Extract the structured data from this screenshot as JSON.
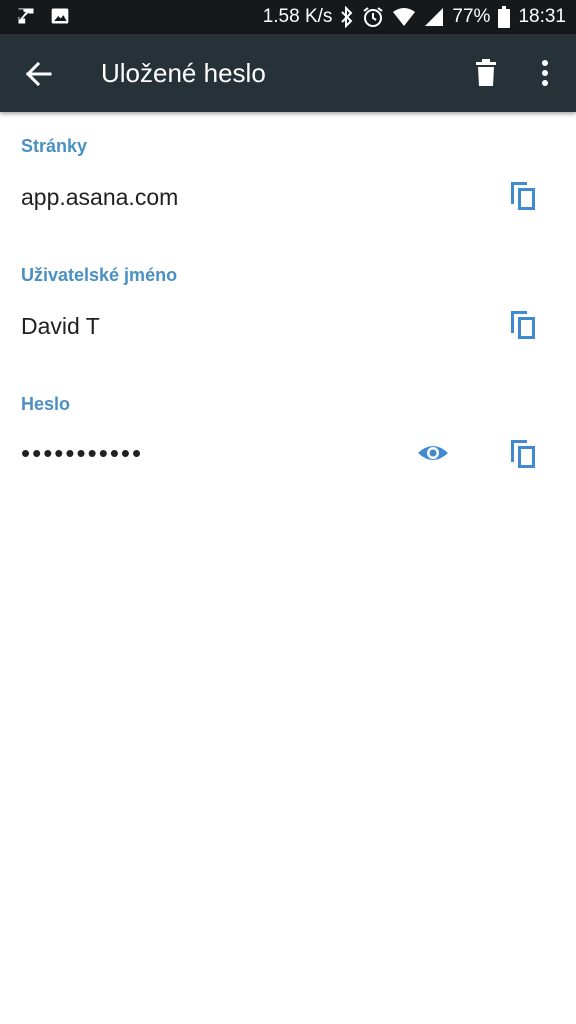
{
  "status_bar": {
    "net_speed": "1.58 K/s",
    "battery": "77%",
    "time": "18:31",
    "icons": [
      "send-icon",
      "image-icon",
      "bluetooth-icon",
      "alarm-icon",
      "wifi-icon",
      "signal-icon",
      "battery-icon"
    ]
  },
  "app_bar": {
    "title": "Uložené heslo",
    "icons": [
      "back-arrow-icon",
      "delete-icon",
      "more-vert-icon"
    ]
  },
  "fields": {
    "site_label": "Stránky",
    "site_value": "app.asana.com",
    "username_label": "Uživatelské jméno",
    "username_value": "David T",
    "password_label": "Heslo",
    "password_value": "•••••••••••"
  },
  "colors": {
    "status_bar_bg": "#15191c",
    "app_bar_bg": "#263238",
    "accent": "#4a90c2",
    "icon_blue": "#3f8ad0",
    "text": "#212121"
  }
}
